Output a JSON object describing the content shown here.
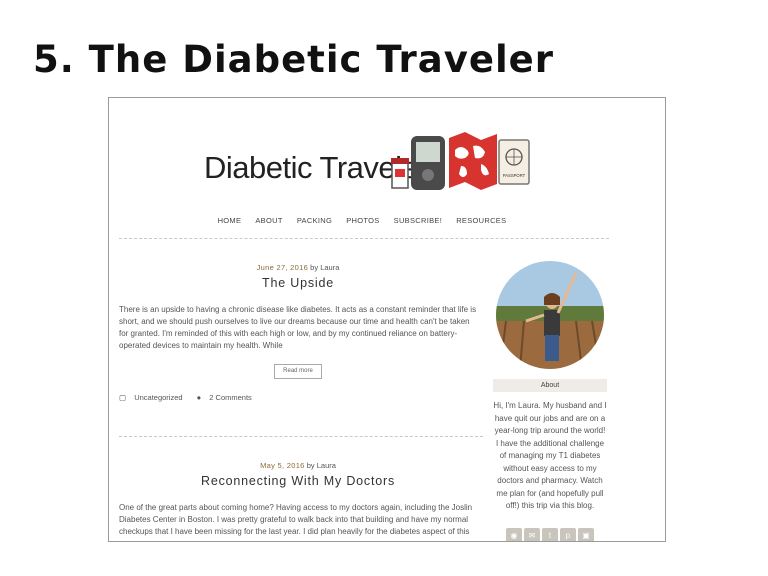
{
  "slide": {
    "title": "5. The Diabetic Traveler"
  },
  "site": {
    "logo_text": "Diabetic Traveler",
    "passport_label": "PASSPORT"
  },
  "nav": [
    "HOME",
    "ABOUT",
    "PACKING",
    "PHOTOS",
    "SUBSCRIBE!",
    "RESOURCES"
  ],
  "posts": [
    {
      "date": "June 27, 2016",
      "by": "by",
      "author": "Laura",
      "title": "The Upside",
      "excerpt": "There is an upside to having a chronic disease like diabetes. It acts as a constant reminder that life is short, and we should push ourselves to live our dreams because our time and health can't be taken for granted. I'm reminded of this with each high or low, and by my continued reliance on battery-operated devices to maintain my health. While",
      "read_more": "Read more",
      "category": "Uncategorized",
      "comments": "2 Comments"
    },
    {
      "date": "May 5, 2016",
      "by": "by",
      "author": "Laura",
      "title": "Reconnecting With My Doctors",
      "excerpt": "One of the great parts about coming home? Having access to my doctors again, including the Joslin Diabetes Center in Boston. I was pretty grateful to walk back into that building and have my normal checkups that I have been missing for the last year. I did plan heavily for the diabetes aspect of this"
    }
  ],
  "sidebar": {
    "about_heading": "About",
    "about_text": "Hi, I'm Laura. My husband and I have quit our jobs and are on a year-long trip around the world! I have the additional challenge of managing my T1 diabetes without easy access to my doctors and pharmacy. Watch me plan for (and hopefully pull off!) this trip via this blog.",
    "socials": [
      "rss-icon",
      "mail-icon",
      "twitter-icon",
      "pinterest-icon",
      "instagram-icon"
    ]
  }
}
